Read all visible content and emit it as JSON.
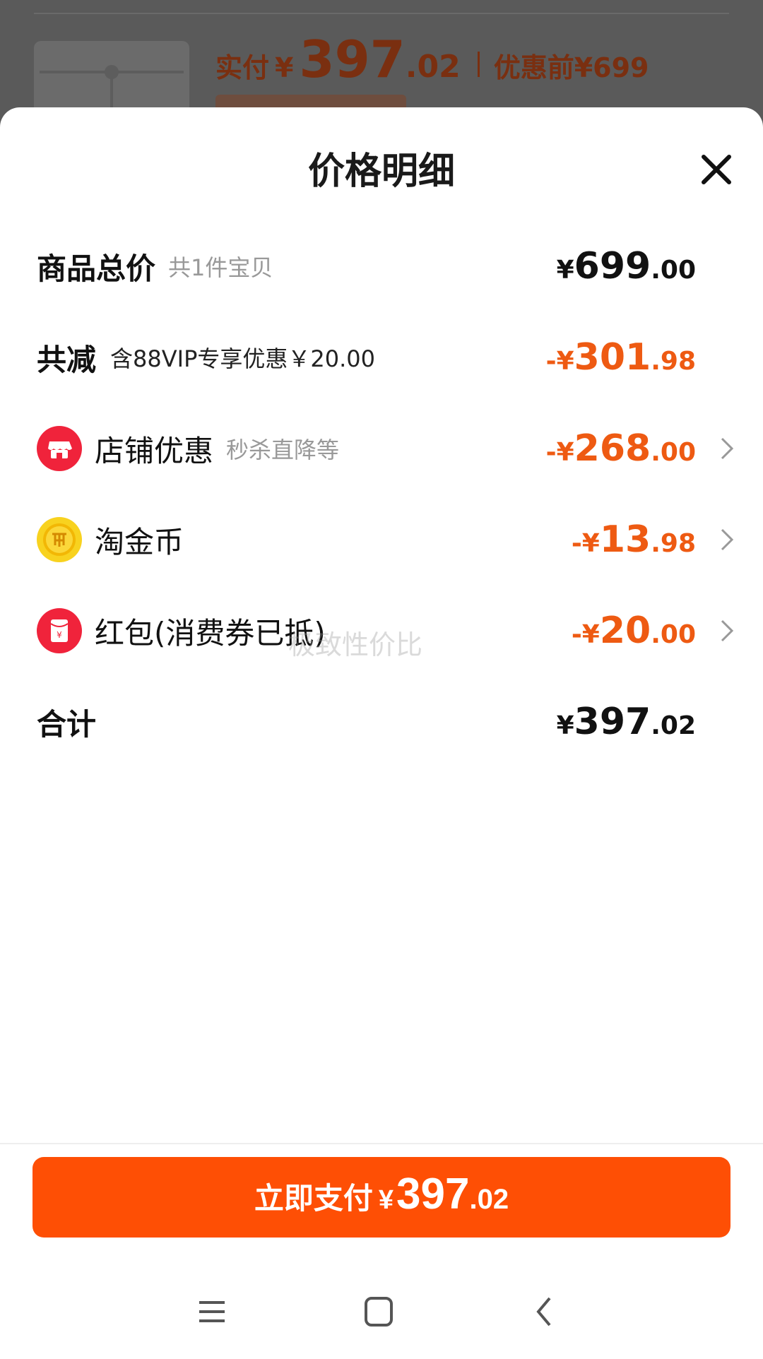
{
  "background": {
    "pay_label": "实付",
    "currency": "¥",
    "pay_int": "397",
    "pay_dec": ".02",
    "orig_label": "优惠前¥699"
  },
  "sheet": {
    "title": "价格明细",
    "close_icon": "close-icon"
  },
  "rows": {
    "subtotal": {
      "label": "商品总价",
      "sub": "共1件宝贝",
      "prefix": "¥",
      "int": "699",
      "dec": ".00"
    },
    "total_off": {
      "label": "共减",
      "sub": "含88VIP专享优惠￥20.00",
      "prefix": "-¥",
      "int": "301",
      "dec": ".98"
    },
    "shop": {
      "label": "店铺优惠",
      "sub": "秒杀直降等",
      "prefix": "-¥",
      "int": "268",
      "dec": ".00",
      "icon": "shop-icon"
    },
    "coins": {
      "label": "淘金币",
      "prefix": "-¥",
      "int": "13",
      "dec": ".98",
      "icon": "coin-icon"
    },
    "redpacket": {
      "label": "红包(消费券已抵)",
      "prefix": "-¥",
      "int": "20",
      "dec": ".00",
      "icon": "red-packet-icon"
    },
    "total": {
      "label": "合计",
      "prefix": "¥",
      "int": "397",
      "dec": ".02"
    }
  },
  "watermark": "极致性价比",
  "pay_button": {
    "label": "立即支付",
    "currency": "¥",
    "int": "397",
    "dec": ".02"
  },
  "navbar": {
    "icons": [
      "menu-icon",
      "home-icon",
      "back-icon"
    ]
  },
  "colors": {
    "accent": "#fe4f05",
    "discount": "#ee5a12",
    "shop_icon": "#f0233b",
    "coin_icon": "#f8d21f"
  }
}
